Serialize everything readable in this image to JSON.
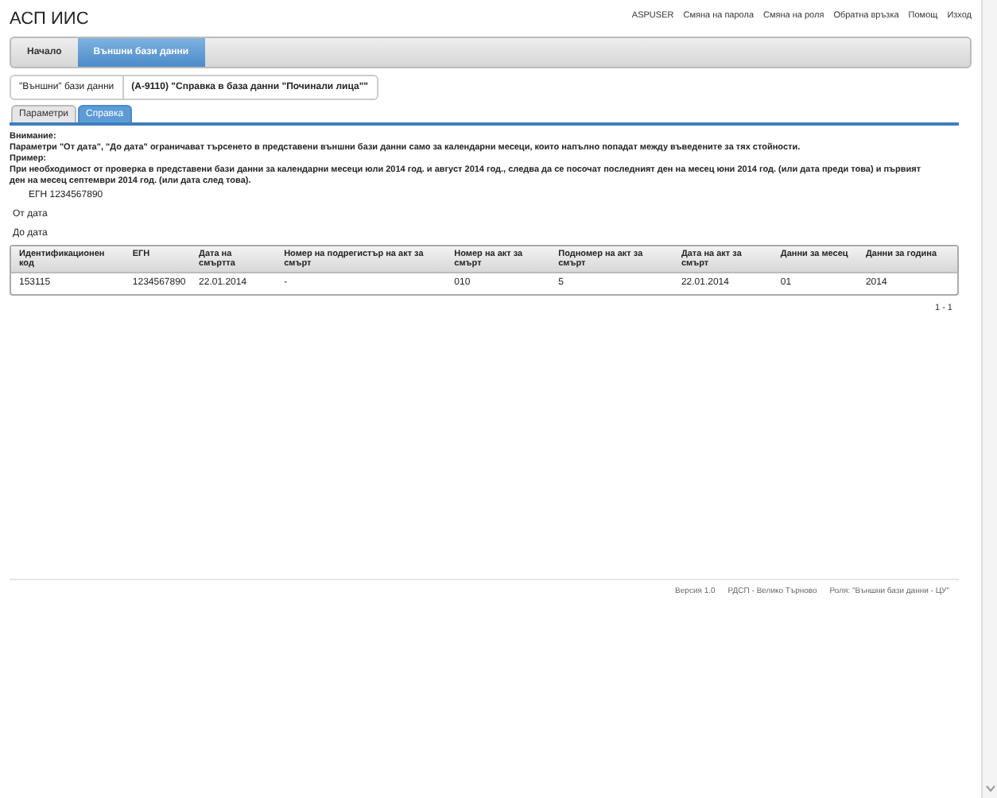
{
  "app_title": "АСП ИИС",
  "user_links": [
    {
      "label": "ASPUSER"
    },
    {
      "label": "Смяна на парола"
    },
    {
      "label": "Смяна на роля"
    },
    {
      "label": "Обратна връзка"
    },
    {
      "label": "Помощ"
    },
    {
      "label": "Изход"
    }
  ],
  "nav": [
    {
      "label": "Начало",
      "selected": false
    },
    {
      "label": "Външни бази данни",
      "selected": true
    }
  ],
  "breadcrumb": [
    {
      "label": "\"Външни\" бази данни"
    },
    {
      "label": "(А-9110) \"Справка в база данни \"Починали лица\"\""
    }
  ],
  "tabs": [
    {
      "label": "Параметри",
      "selected": false
    },
    {
      "label": "Справка",
      "selected": true
    }
  ],
  "notice": {
    "title": "Внимание:",
    "text": "Параметри \"От дата\", \"До дата\" ограничават търсенето в представени външни бази данни само за календарни месеци, които напълно попадат между въведените за тях стойности.",
    "example_title": "Пример:",
    "example_text": "При необходимост от проверка в представени бази данни за календарни месеци юли 2014 год. и август 2014 год., следва да се посочат последният ден на месец юни 2014 год. (или дата преди това) и първият ден на месец септември 2014 год. (или дата след това)."
  },
  "params": [
    {
      "label": "ЕГН 1234567890",
      "indented": true
    },
    {
      "label": "От дата",
      "indented": false
    },
    {
      "label": "До дата",
      "indented": false
    }
  ],
  "table": {
    "columns": [
      "Идентификационен код",
      "ЕГН",
      "Дата на смъртта",
      "Номер на подрегистър на акт за смърт",
      "Номер на акт за смърт",
      "Подномер на акт за смърт",
      "Дата на акт за смърт",
      "Данни за месец",
      "Данни за година"
    ],
    "rows": [
      [
        "153115",
        "1234567890",
        "22.01.2014",
        "-",
        "010",
        "5",
        "22.01.2014",
        "01",
        "2014"
      ]
    ]
  },
  "pager": "1 - 1",
  "footer": [
    {
      "label": "Версия 1.0"
    },
    {
      "label": "РДСП - Велико Търново"
    },
    {
      "label": "Роля: \"Външни бази данни - ЦУ\""
    }
  ]
}
